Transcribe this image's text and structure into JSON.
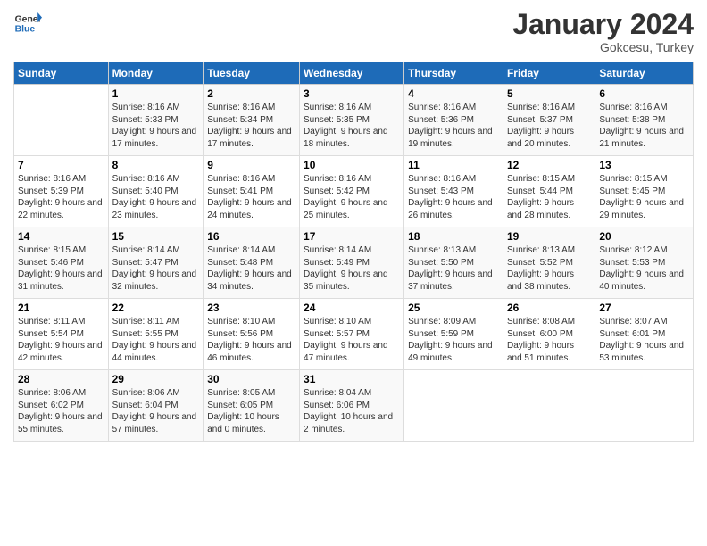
{
  "header": {
    "logo_general": "General",
    "logo_blue": "Blue",
    "month": "January 2024",
    "location": "Gokcesu, Turkey"
  },
  "days_of_week": [
    "Sunday",
    "Monday",
    "Tuesday",
    "Wednesday",
    "Thursday",
    "Friday",
    "Saturday"
  ],
  "weeks": [
    [
      {
        "day": "",
        "sunrise": "",
        "sunset": "",
        "daylight": ""
      },
      {
        "day": "1",
        "sunrise": "Sunrise: 8:16 AM",
        "sunset": "Sunset: 5:33 PM",
        "daylight": "Daylight: 9 hours and 17 minutes."
      },
      {
        "day": "2",
        "sunrise": "Sunrise: 8:16 AM",
        "sunset": "Sunset: 5:34 PM",
        "daylight": "Daylight: 9 hours and 17 minutes."
      },
      {
        "day": "3",
        "sunrise": "Sunrise: 8:16 AM",
        "sunset": "Sunset: 5:35 PM",
        "daylight": "Daylight: 9 hours and 18 minutes."
      },
      {
        "day": "4",
        "sunrise": "Sunrise: 8:16 AM",
        "sunset": "Sunset: 5:36 PM",
        "daylight": "Daylight: 9 hours and 19 minutes."
      },
      {
        "day": "5",
        "sunrise": "Sunrise: 8:16 AM",
        "sunset": "Sunset: 5:37 PM",
        "daylight": "Daylight: 9 hours and 20 minutes."
      },
      {
        "day": "6",
        "sunrise": "Sunrise: 8:16 AM",
        "sunset": "Sunset: 5:38 PM",
        "daylight": "Daylight: 9 hours and 21 minutes."
      }
    ],
    [
      {
        "day": "7",
        "sunrise": "Sunrise: 8:16 AM",
        "sunset": "Sunset: 5:39 PM",
        "daylight": "Daylight: 9 hours and 22 minutes."
      },
      {
        "day": "8",
        "sunrise": "Sunrise: 8:16 AM",
        "sunset": "Sunset: 5:40 PM",
        "daylight": "Daylight: 9 hours and 23 minutes."
      },
      {
        "day": "9",
        "sunrise": "Sunrise: 8:16 AM",
        "sunset": "Sunset: 5:41 PM",
        "daylight": "Daylight: 9 hours and 24 minutes."
      },
      {
        "day": "10",
        "sunrise": "Sunrise: 8:16 AM",
        "sunset": "Sunset: 5:42 PM",
        "daylight": "Daylight: 9 hours and 25 minutes."
      },
      {
        "day": "11",
        "sunrise": "Sunrise: 8:16 AM",
        "sunset": "Sunset: 5:43 PM",
        "daylight": "Daylight: 9 hours and 26 minutes."
      },
      {
        "day": "12",
        "sunrise": "Sunrise: 8:15 AM",
        "sunset": "Sunset: 5:44 PM",
        "daylight": "Daylight: 9 hours and 28 minutes."
      },
      {
        "day": "13",
        "sunrise": "Sunrise: 8:15 AM",
        "sunset": "Sunset: 5:45 PM",
        "daylight": "Daylight: 9 hours and 29 minutes."
      }
    ],
    [
      {
        "day": "14",
        "sunrise": "Sunrise: 8:15 AM",
        "sunset": "Sunset: 5:46 PM",
        "daylight": "Daylight: 9 hours and 31 minutes."
      },
      {
        "day": "15",
        "sunrise": "Sunrise: 8:14 AM",
        "sunset": "Sunset: 5:47 PM",
        "daylight": "Daylight: 9 hours and 32 minutes."
      },
      {
        "day": "16",
        "sunrise": "Sunrise: 8:14 AM",
        "sunset": "Sunset: 5:48 PM",
        "daylight": "Daylight: 9 hours and 34 minutes."
      },
      {
        "day": "17",
        "sunrise": "Sunrise: 8:14 AM",
        "sunset": "Sunset: 5:49 PM",
        "daylight": "Daylight: 9 hours and 35 minutes."
      },
      {
        "day": "18",
        "sunrise": "Sunrise: 8:13 AM",
        "sunset": "Sunset: 5:50 PM",
        "daylight": "Daylight: 9 hours and 37 minutes."
      },
      {
        "day": "19",
        "sunrise": "Sunrise: 8:13 AM",
        "sunset": "Sunset: 5:52 PM",
        "daylight": "Daylight: 9 hours and 38 minutes."
      },
      {
        "day": "20",
        "sunrise": "Sunrise: 8:12 AM",
        "sunset": "Sunset: 5:53 PM",
        "daylight": "Daylight: 9 hours and 40 minutes."
      }
    ],
    [
      {
        "day": "21",
        "sunrise": "Sunrise: 8:11 AM",
        "sunset": "Sunset: 5:54 PM",
        "daylight": "Daylight: 9 hours and 42 minutes."
      },
      {
        "day": "22",
        "sunrise": "Sunrise: 8:11 AM",
        "sunset": "Sunset: 5:55 PM",
        "daylight": "Daylight: 9 hours and 44 minutes."
      },
      {
        "day": "23",
        "sunrise": "Sunrise: 8:10 AM",
        "sunset": "Sunset: 5:56 PM",
        "daylight": "Daylight: 9 hours and 46 minutes."
      },
      {
        "day": "24",
        "sunrise": "Sunrise: 8:10 AM",
        "sunset": "Sunset: 5:57 PM",
        "daylight": "Daylight: 9 hours and 47 minutes."
      },
      {
        "day": "25",
        "sunrise": "Sunrise: 8:09 AM",
        "sunset": "Sunset: 5:59 PM",
        "daylight": "Daylight: 9 hours and 49 minutes."
      },
      {
        "day": "26",
        "sunrise": "Sunrise: 8:08 AM",
        "sunset": "Sunset: 6:00 PM",
        "daylight": "Daylight: 9 hours and 51 minutes."
      },
      {
        "day": "27",
        "sunrise": "Sunrise: 8:07 AM",
        "sunset": "Sunset: 6:01 PM",
        "daylight": "Daylight: 9 hours and 53 minutes."
      }
    ],
    [
      {
        "day": "28",
        "sunrise": "Sunrise: 8:06 AM",
        "sunset": "Sunset: 6:02 PM",
        "daylight": "Daylight: 9 hours and 55 minutes."
      },
      {
        "day": "29",
        "sunrise": "Sunrise: 8:06 AM",
        "sunset": "Sunset: 6:04 PM",
        "daylight": "Daylight: 9 hours and 57 minutes."
      },
      {
        "day": "30",
        "sunrise": "Sunrise: 8:05 AM",
        "sunset": "Sunset: 6:05 PM",
        "daylight": "Daylight: 10 hours and 0 minutes."
      },
      {
        "day": "31",
        "sunrise": "Sunrise: 8:04 AM",
        "sunset": "Sunset: 6:06 PM",
        "daylight": "Daylight: 10 hours and 2 minutes."
      },
      {
        "day": "",
        "sunrise": "",
        "sunset": "",
        "daylight": ""
      },
      {
        "day": "",
        "sunrise": "",
        "sunset": "",
        "daylight": ""
      },
      {
        "day": "",
        "sunrise": "",
        "sunset": "",
        "daylight": ""
      }
    ]
  ]
}
